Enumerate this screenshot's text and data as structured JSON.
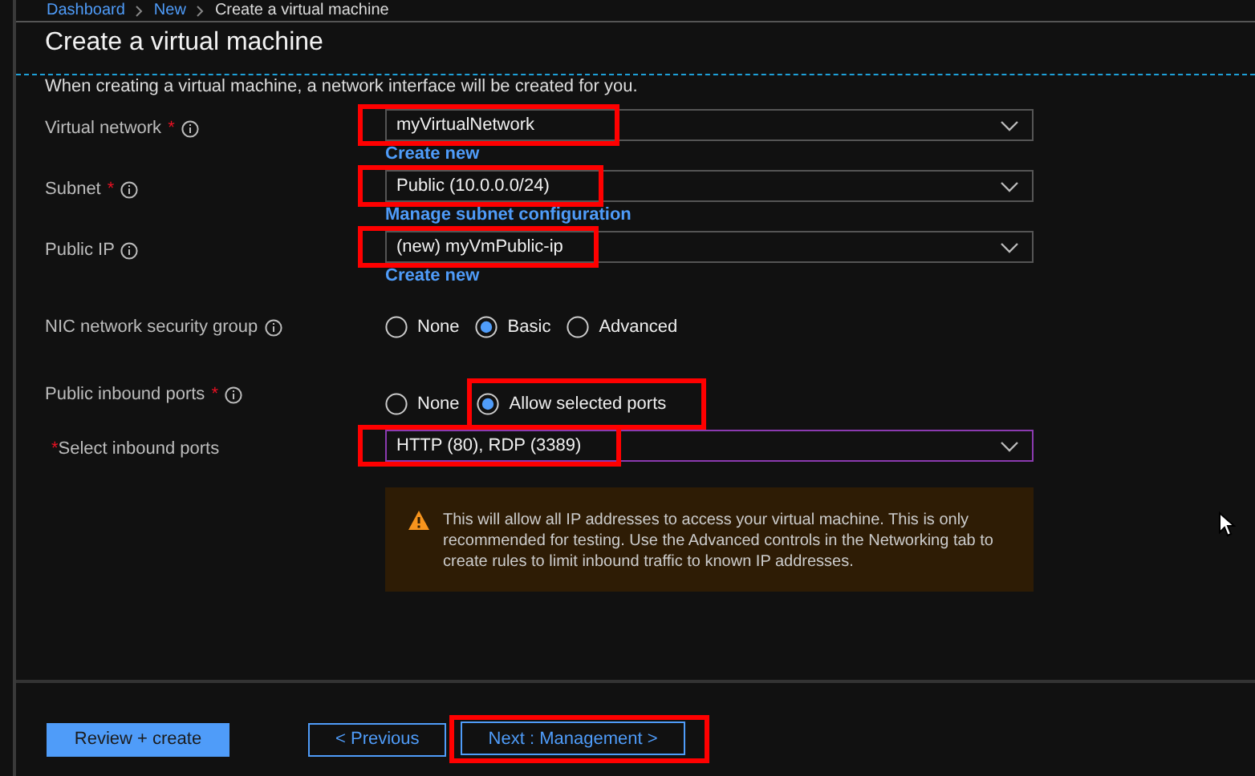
{
  "breadcrumb": [
    "Dashboard",
    "New",
    "Create a virtual machine"
  ],
  "title": "Create a virtual machine",
  "intro": "When creating a virtual machine, a network interface will be created for you.",
  "fields": [
    {
      "kind": "dropdown",
      "label": "Virtual network",
      "required_mark": "*",
      "star_first": false,
      "info": true,
      "value": "myVirtualNetwork",
      "link": "Create new",
      "highlighted": true,
      "focused": false
    },
    {
      "kind": "dropdown",
      "label": "Subnet",
      "required_mark": "*",
      "star_first": false,
      "info": true,
      "value": "Public (10.0.0.0/24)",
      "link": "Manage subnet configuration",
      "highlighted": true,
      "focused": false
    },
    {
      "kind": "dropdown",
      "label": "Public IP",
      "info": true,
      "value": "(new) myVmPublic-ip",
      "link": "Create new",
      "highlighted": true,
      "focused": false
    },
    {
      "kind": "radio",
      "label": "NIC network security group",
      "info": true,
      "options": [
        {
          "label": "None",
          "selected": false,
          "highlighted": false
        },
        {
          "label": "Basic",
          "selected": true,
          "highlighted": false
        },
        {
          "label": "Advanced",
          "selected": false,
          "highlighted": false
        }
      ]
    },
    {
      "kind": "radio",
      "label": "Public inbound ports",
      "required_mark": "*",
      "star_first": false,
      "info": true,
      "options": [
        {
          "label": "None",
          "selected": false,
          "highlighted": false
        },
        {
          "label": "Allow selected ports",
          "selected": true,
          "highlighted": true
        }
      ]
    },
    {
      "kind": "dropdown",
      "label": "Select inbound ports",
      "required_mark": "*",
      "star_first": true,
      "info": false,
      "value": "HTTP (80), RDP (3389)",
      "highlighted": true,
      "focused": true
    }
  ],
  "warning": "This will allow all IP addresses to access your virtual machine.  This is only recommended for testing.  Use the Advanced controls in the Networking tab to create rules to limit inbound traffic to known IP addresses.",
  "buttons": [
    {
      "label": "Review + create",
      "kind": "primary",
      "highlighted": false
    },
    {
      "label": "< Previous",
      "kind": "secondary",
      "highlighted": false
    },
    {
      "label": "Next : Management >",
      "kind": "secondary",
      "highlighted": true
    }
  ]
}
